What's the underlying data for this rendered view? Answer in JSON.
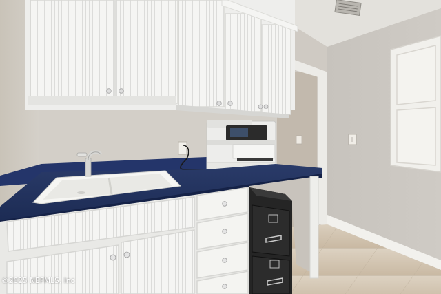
{
  "photo": {
    "scene": "laundry-room-utility-area",
    "watermark": "©2025 NEFMLS, Inc"
  },
  "colors": {
    "wall": "#cbc7c0",
    "cabinet": "#f3f3f1",
    "countertop": "#1f2f5a",
    "floor": "#d6c8b5",
    "ceiling": "#e4e2dd",
    "file_cabinet": "#242424"
  }
}
